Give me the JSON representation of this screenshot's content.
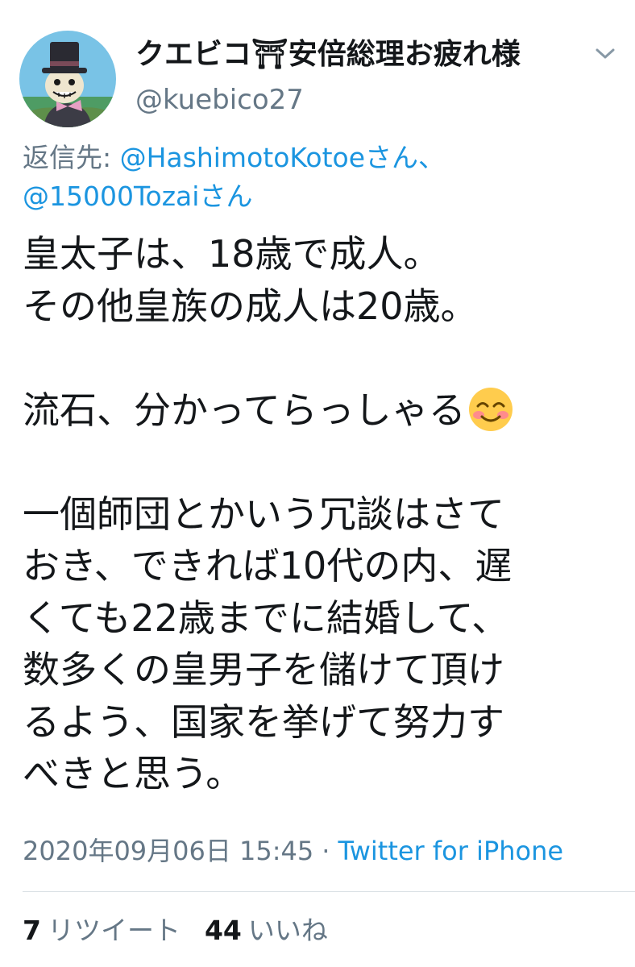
{
  "author": {
    "display_name": "クエビコ⛩安倍総理お疲れ様",
    "handle": "@kuebico27",
    "avatar_icon": "avatar-scarecrow-icon"
  },
  "reply_to": {
    "prefix": "返信先: ",
    "user1": "@HashimotoKotoe",
    "suffix1": "さん、",
    "user2": "@15000Tozai",
    "suffix2": "さん"
  },
  "tweet": {
    "lines": [
      "皇太子は、18歳で成人。",
      "その他皇族の成人は20歳。",
      "",
      "流石、分かってらっしゃる",
      "",
      "一個師団とかいう冗談はさて",
      "おき、できれば10代の内、遅",
      "くても22歳までに結婚して、",
      "数多くの皇男子を儲けて頂け",
      "るよう、国家を挙げて努力す",
      "べきと思う。"
    ],
    "emoji": "smiling-face-with-smiling-eyes"
  },
  "meta": {
    "timestamp": "2020年09月06日 15:45",
    "separator": "·",
    "source": "Twitter for iPhone"
  },
  "stats": {
    "retweets_count": "7",
    "retweets_label": "リツイート",
    "likes_count": "44",
    "likes_label": "いいね"
  },
  "colors": {
    "text": "#14171a",
    "muted": "#657786",
    "link": "#1b95e0",
    "divider": "#d9dfe4"
  }
}
